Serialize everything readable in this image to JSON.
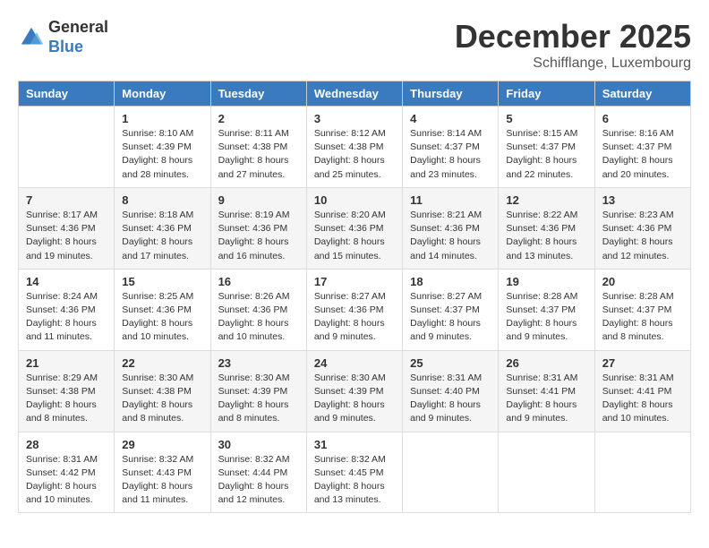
{
  "logo": {
    "general": "General",
    "blue": "Blue"
  },
  "title": "December 2025",
  "location": "Schifflange, Luxembourg",
  "days_of_week": [
    "Sunday",
    "Monday",
    "Tuesday",
    "Wednesday",
    "Thursday",
    "Friday",
    "Saturday"
  ],
  "weeks": [
    [
      {
        "num": "",
        "sunrise": "",
        "sunset": "",
        "daylight": ""
      },
      {
        "num": "1",
        "sunrise": "Sunrise: 8:10 AM",
        "sunset": "Sunset: 4:39 PM",
        "daylight": "Daylight: 8 hours and 28 minutes."
      },
      {
        "num": "2",
        "sunrise": "Sunrise: 8:11 AM",
        "sunset": "Sunset: 4:38 PM",
        "daylight": "Daylight: 8 hours and 27 minutes."
      },
      {
        "num": "3",
        "sunrise": "Sunrise: 8:12 AM",
        "sunset": "Sunset: 4:38 PM",
        "daylight": "Daylight: 8 hours and 25 minutes."
      },
      {
        "num": "4",
        "sunrise": "Sunrise: 8:14 AM",
        "sunset": "Sunset: 4:37 PM",
        "daylight": "Daylight: 8 hours and 23 minutes."
      },
      {
        "num": "5",
        "sunrise": "Sunrise: 8:15 AM",
        "sunset": "Sunset: 4:37 PM",
        "daylight": "Daylight: 8 hours and 22 minutes."
      },
      {
        "num": "6",
        "sunrise": "Sunrise: 8:16 AM",
        "sunset": "Sunset: 4:37 PM",
        "daylight": "Daylight: 8 hours and 20 minutes."
      }
    ],
    [
      {
        "num": "7",
        "sunrise": "Sunrise: 8:17 AM",
        "sunset": "Sunset: 4:36 PM",
        "daylight": "Daylight: 8 hours and 19 minutes."
      },
      {
        "num": "8",
        "sunrise": "Sunrise: 8:18 AM",
        "sunset": "Sunset: 4:36 PM",
        "daylight": "Daylight: 8 hours and 17 minutes."
      },
      {
        "num": "9",
        "sunrise": "Sunrise: 8:19 AM",
        "sunset": "Sunset: 4:36 PM",
        "daylight": "Daylight: 8 hours and 16 minutes."
      },
      {
        "num": "10",
        "sunrise": "Sunrise: 8:20 AM",
        "sunset": "Sunset: 4:36 PM",
        "daylight": "Daylight: 8 hours and 15 minutes."
      },
      {
        "num": "11",
        "sunrise": "Sunrise: 8:21 AM",
        "sunset": "Sunset: 4:36 PM",
        "daylight": "Daylight: 8 hours and 14 minutes."
      },
      {
        "num": "12",
        "sunrise": "Sunrise: 8:22 AM",
        "sunset": "Sunset: 4:36 PM",
        "daylight": "Daylight: 8 hours and 13 minutes."
      },
      {
        "num": "13",
        "sunrise": "Sunrise: 8:23 AM",
        "sunset": "Sunset: 4:36 PM",
        "daylight": "Daylight: 8 hours and 12 minutes."
      }
    ],
    [
      {
        "num": "14",
        "sunrise": "Sunrise: 8:24 AM",
        "sunset": "Sunset: 4:36 PM",
        "daylight": "Daylight: 8 hours and 11 minutes."
      },
      {
        "num": "15",
        "sunrise": "Sunrise: 8:25 AM",
        "sunset": "Sunset: 4:36 PM",
        "daylight": "Daylight: 8 hours and 10 minutes."
      },
      {
        "num": "16",
        "sunrise": "Sunrise: 8:26 AM",
        "sunset": "Sunset: 4:36 PM",
        "daylight": "Daylight: 8 hours and 10 minutes."
      },
      {
        "num": "17",
        "sunrise": "Sunrise: 8:27 AM",
        "sunset": "Sunset: 4:36 PM",
        "daylight": "Daylight: 8 hours and 9 minutes."
      },
      {
        "num": "18",
        "sunrise": "Sunrise: 8:27 AM",
        "sunset": "Sunset: 4:37 PM",
        "daylight": "Daylight: 8 hours and 9 minutes."
      },
      {
        "num": "19",
        "sunrise": "Sunrise: 8:28 AM",
        "sunset": "Sunset: 4:37 PM",
        "daylight": "Daylight: 8 hours and 9 minutes."
      },
      {
        "num": "20",
        "sunrise": "Sunrise: 8:28 AM",
        "sunset": "Sunset: 4:37 PM",
        "daylight": "Daylight: 8 hours and 8 minutes."
      }
    ],
    [
      {
        "num": "21",
        "sunrise": "Sunrise: 8:29 AM",
        "sunset": "Sunset: 4:38 PM",
        "daylight": "Daylight: 8 hours and 8 minutes."
      },
      {
        "num": "22",
        "sunrise": "Sunrise: 8:30 AM",
        "sunset": "Sunset: 4:38 PM",
        "daylight": "Daylight: 8 hours and 8 minutes."
      },
      {
        "num": "23",
        "sunrise": "Sunrise: 8:30 AM",
        "sunset": "Sunset: 4:39 PM",
        "daylight": "Daylight: 8 hours and 8 minutes."
      },
      {
        "num": "24",
        "sunrise": "Sunrise: 8:30 AM",
        "sunset": "Sunset: 4:39 PM",
        "daylight": "Daylight: 8 hours and 9 minutes."
      },
      {
        "num": "25",
        "sunrise": "Sunrise: 8:31 AM",
        "sunset": "Sunset: 4:40 PM",
        "daylight": "Daylight: 8 hours and 9 minutes."
      },
      {
        "num": "26",
        "sunrise": "Sunrise: 8:31 AM",
        "sunset": "Sunset: 4:41 PM",
        "daylight": "Daylight: 8 hours and 9 minutes."
      },
      {
        "num": "27",
        "sunrise": "Sunrise: 8:31 AM",
        "sunset": "Sunset: 4:41 PM",
        "daylight": "Daylight: 8 hours and 10 minutes."
      }
    ],
    [
      {
        "num": "28",
        "sunrise": "Sunrise: 8:31 AM",
        "sunset": "Sunset: 4:42 PM",
        "daylight": "Daylight: 8 hours and 10 minutes."
      },
      {
        "num": "29",
        "sunrise": "Sunrise: 8:32 AM",
        "sunset": "Sunset: 4:43 PM",
        "daylight": "Daylight: 8 hours and 11 minutes."
      },
      {
        "num": "30",
        "sunrise": "Sunrise: 8:32 AM",
        "sunset": "Sunset: 4:44 PM",
        "daylight": "Daylight: 8 hours and 12 minutes."
      },
      {
        "num": "31",
        "sunrise": "Sunrise: 8:32 AM",
        "sunset": "Sunset: 4:45 PM",
        "daylight": "Daylight: 8 hours and 13 minutes."
      },
      {
        "num": "",
        "sunrise": "",
        "sunset": "",
        "daylight": ""
      },
      {
        "num": "",
        "sunrise": "",
        "sunset": "",
        "daylight": ""
      },
      {
        "num": "",
        "sunrise": "",
        "sunset": "",
        "daylight": ""
      }
    ]
  ]
}
